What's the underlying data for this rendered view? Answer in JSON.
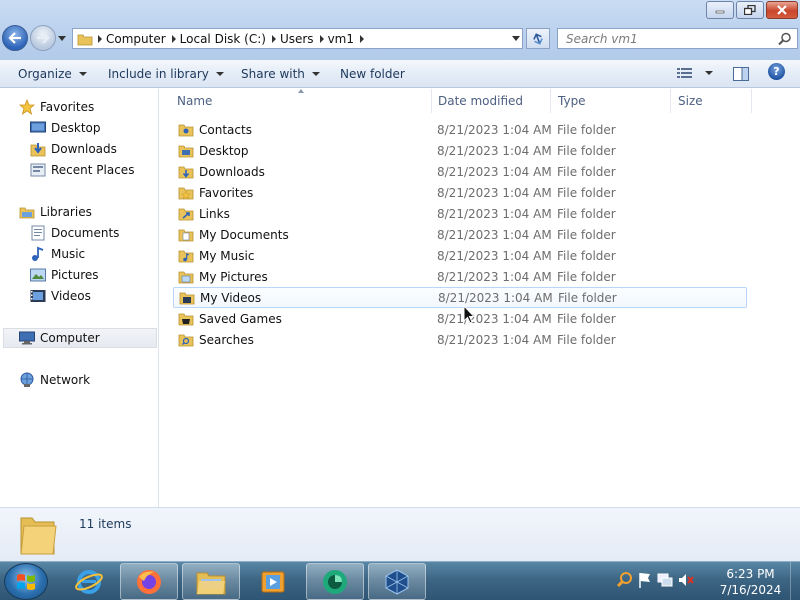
{
  "window": {
    "buttons": {
      "minimize": "minimize",
      "maximize": "maximize",
      "close": "close"
    }
  },
  "address": {
    "crumbs": [
      "Computer",
      "Local Disk (C:)",
      "Users",
      "vm1"
    ]
  },
  "search": {
    "placeholder": "Search vm1"
  },
  "toolbar": {
    "organize": "Organize",
    "include_in_library": "Include in library",
    "share_with": "Share with",
    "new_folder": "New folder"
  },
  "navigation": {
    "favorites": {
      "label": "Favorites",
      "items": [
        {
          "label": "Desktop",
          "icon": "desktop-icon"
        },
        {
          "label": "Downloads",
          "icon": "downloads-icon"
        },
        {
          "label": "Recent Places",
          "icon": "recent-places-icon"
        }
      ]
    },
    "libraries": {
      "label": "Libraries",
      "items": [
        {
          "label": "Documents",
          "icon": "documents-icon"
        },
        {
          "label": "Music",
          "icon": "music-icon"
        },
        {
          "label": "Pictures",
          "icon": "pictures-icon"
        },
        {
          "label": "Videos",
          "icon": "videos-icon"
        }
      ]
    },
    "computer": {
      "label": "Computer",
      "selected": true
    },
    "network": {
      "label": "Network"
    }
  },
  "columns": {
    "name": "Name",
    "date_modified": "Date modified",
    "type": "Type",
    "size": "Size"
  },
  "files": [
    {
      "name": "Contacts",
      "date": "8/21/2023 1:04 AM",
      "type": "File folder",
      "icon": "contacts-folder-icon"
    },
    {
      "name": "Desktop",
      "date": "8/21/2023 1:04 AM",
      "type": "File folder",
      "icon": "desktop-folder-icon"
    },
    {
      "name": "Downloads",
      "date": "8/21/2023 1:04 AM",
      "type": "File folder",
      "icon": "downloads-folder-icon"
    },
    {
      "name": "Favorites",
      "date": "8/21/2023 1:04 AM",
      "type": "File folder",
      "icon": "favorites-folder-icon"
    },
    {
      "name": "Links",
      "date": "8/21/2023 1:04 AM",
      "type": "File folder",
      "icon": "links-folder-icon"
    },
    {
      "name": "My Documents",
      "date": "8/21/2023 1:04 AM",
      "type": "File folder",
      "icon": "documents-folder-icon"
    },
    {
      "name": "My Music",
      "date": "8/21/2023 1:04 AM",
      "type": "File folder",
      "icon": "music-folder-icon"
    },
    {
      "name": "My Pictures",
      "date": "8/21/2023 1:04 AM",
      "type": "File folder",
      "icon": "pictures-folder-icon"
    },
    {
      "name": "My Videos",
      "date": "8/21/2023 1:04 AM",
      "type": "File folder",
      "icon": "videos-folder-icon",
      "hovered": true
    },
    {
      "name": "Saved Games",
      "date": "8/21/2023 1:04 AM",
      "type": "File folder",
      "icon": "saved-games-folder-icon"
    },
    {
      "name": "Searches",
      "date": "8/21/2023 1:04 AM",
      "type": "File folder",
      "icon": "searches-folder-icon"
    }
  ],
  "status": {
    "item_count": "11 items"
  },
  "taskbar": {
    "pinned": [
      {
        "name": "internet-explorer-icon",
        "open": false
      },
      {
        "name": "firefox-icon",
        "open": true
      },
      {
        "name": "windows-explorer-icon",
        "open": true
      },
      {
        "name": "media-player-icon",
        "open": false
      },
      {
        "name": "app-green-icon",
        "open": true
      },
      {
        "name": "virtualbox-icon",
        "open": true
      }
    ],
    "clock": {
      "time": "6:23 PM",
      "date": "7/16/2024"
    }
  },
  "colors": {
    "accent": "#1e395b",
    "folder_yellow": "#f3d27a",
    "taskbar": "#3d6684",
    "close_red": "#c9462c"
  }
}
